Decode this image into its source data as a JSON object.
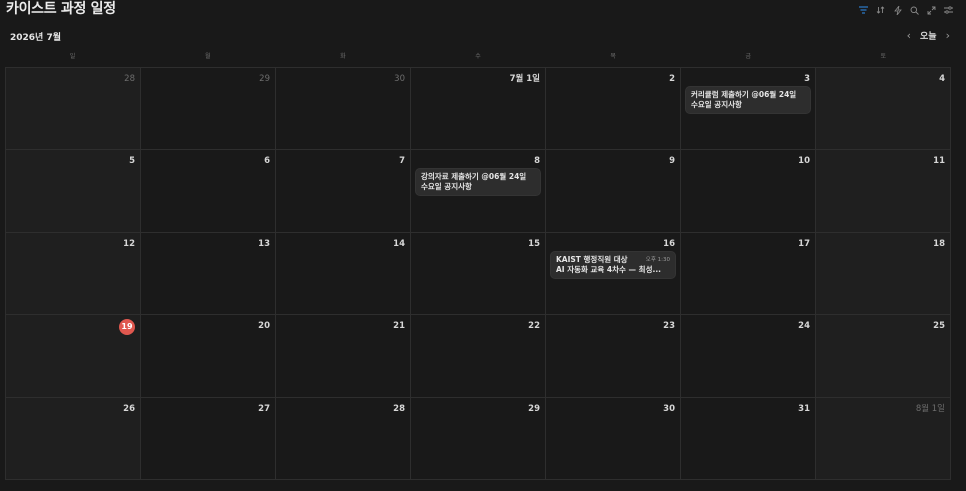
{
  "page_title": "카이스트 과정 일정",
  "toolbar": {
    "icons": [
      "filter-icon",
      "sort-icon",
      "lightning-icon",
      "search-icon",
      "expand-icon",
      "settings-icon"
    ]
  },
  "month_label": "2026년 7월",
  "nav": {
    "prev": "‹",
    "today": "오늘",
    "next": "›"
  },
  "weekdays": [
    "일",
    "월",
    "화",
    "수",
    "목",
    "금",
    "토"
  ],
  "weeks": [
    [
      {
        "day": "28",
        "dim": true
      },
      {
        "day": "29",
        "dim": true
      },
      {
        "day": "30",
        "dim": true
      },
      {
        "day": "7월 1일"
      },
      {
        "day": "2"
      },
      {
        "day": "3",
        "events": [
          {
            "title": "커리큘럼 제출하기 @06월 24일 수요일 공지사항"
          }
        ]
      },
      {
        "day": "4"
      }
    ],
    [
      {
        "day": "5"
      },
      {
        "day": "6"
      },
      {
        "day": "7"
      },
      {
        "day": "8",
        "events": [
          {
            "title": "강의자료 제출하기 @06월 24일 수요일 공지사항"
          }
        ]
      },
      {
        "day": "9"
      },
      {
        "day": "10"
      },
      {
        "day": "11"
      }
    ],
    [
      {
        "day": "12"
      },
      {
        "day": "13"
      },
      {
        "day": "14"
      },
      {
        "day": "15"
      },
      {
        "day": "16",
        "events": [
          {
            "title_line1": "KAIST 행정직원 대상",
            "time": "오후 1:30",
            "title_line2": "AI 자동화 교육 4차수 — 최성..."
          }
        ]
      },
      {
        "day": "17"
      },
      {
        "day": "18"
      }
    ],
    [
      {
        "day": "19",
        "today": true
      },
      {
        "day": "20"
      },
      {
        "day": "21"
      },
      {
        "day": "22"
      },
      {
        "day": "23"
      },
      {
        "day": "24"
      },
      {
        "day": "25"
      }
    ],
    [
      {
        "day": "26"
      },
      {
        "day": "27"
      },
      {
        "day": "28"
      },
      {
        "day": "29"
      },
      {
        "day": "30"
      },
      {
        "day": "31"
      },
      {
        "day": "8월 1일",
        "dim": true
      }
    ]
  ],
  "colors": {
    "background": "#191919",
    "weekend_background": "#1f1f1f",
    "today_badge": "#e0584f",
    "accent": "#2f8ef0"
  }
}
